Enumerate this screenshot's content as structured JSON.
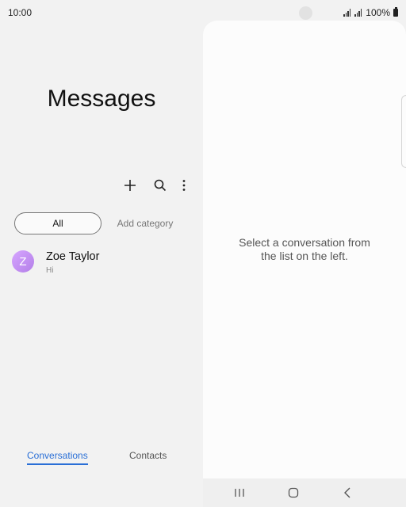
{
  "status": {
    "time": "10:00",
    "battery": "100%"
  },
  "app": {
    "title": "Messages"
  },
  "categories": {
    "all": "All",
    "add": "Add category"
  },
  "conversations": [
    {
      "initial": "Z",
      "name": "Zoe Taylor",
      "preview": "Hi"
    }
  ],
  "nav": {
    "conversations": "Conversations",
    "contacts": "Contacts"
  },
  "detail": {
    "placeholder_line1": "Select a conversation from",
    "placeholder_line2": "the list on the left."
  },
  "colors": {
    "accent": "#2a6fd6",
    "avatar": "#c48ff2"
  }
}
